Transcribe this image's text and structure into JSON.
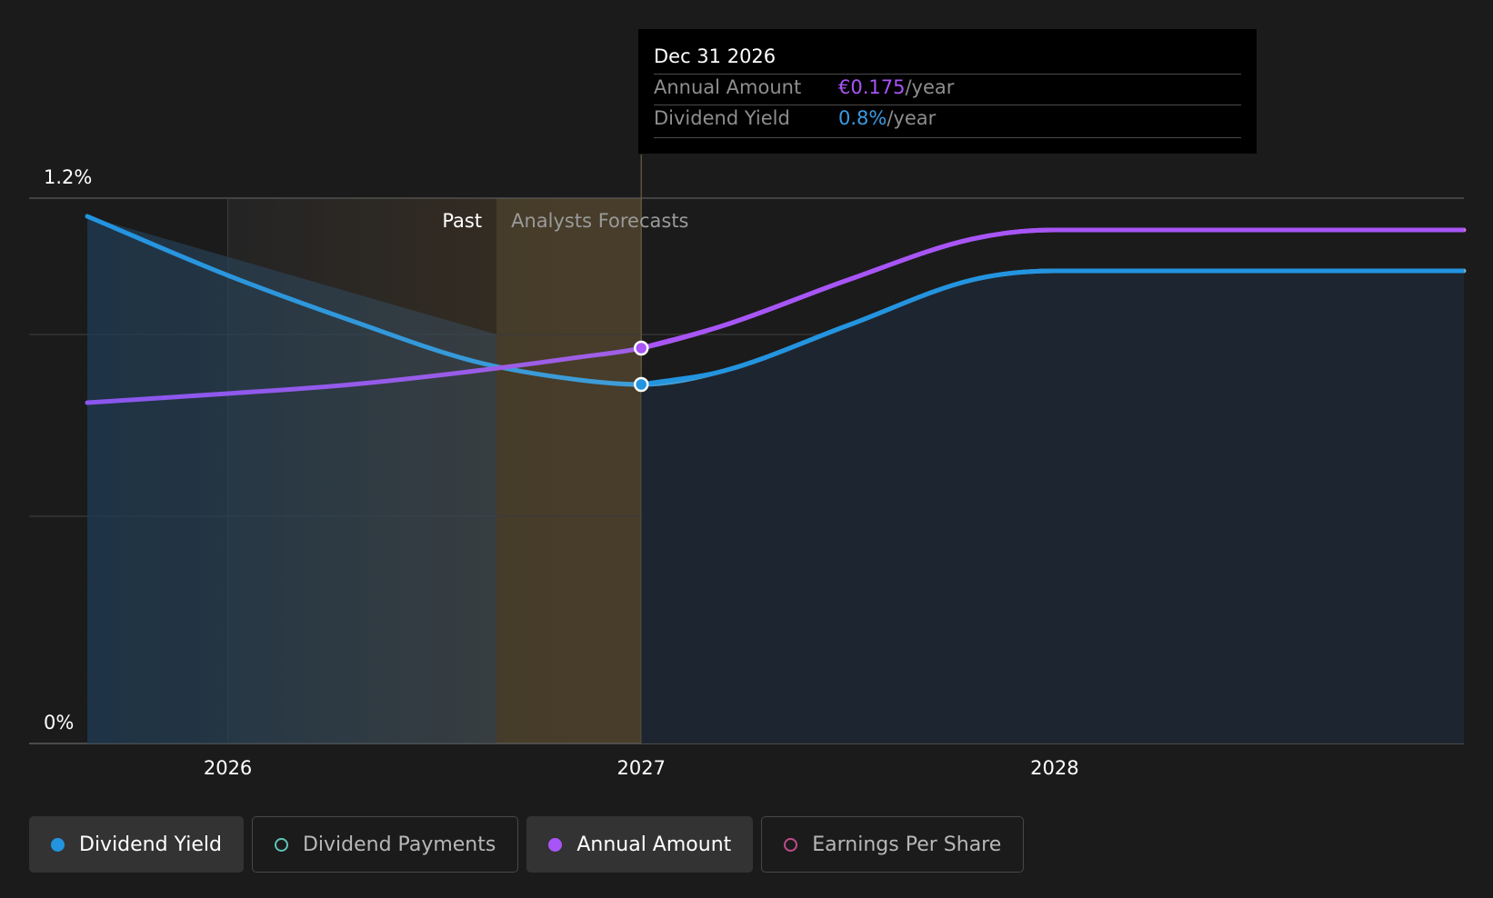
{
  "tooltip": {
    "date": "Dec 31 2026",
    "rows": [
      {
        "label": "Annual Amount",
        "value": "€0.175",
        "unit": "/year",
        "color": "#a855f7"
      },
      {
        "label": "Dividend Yield",
        "value": "0.8%",
        "unit": "/year",
        "color": "#3b9ae1"
      }
    ]
  },
  "regions": {
    "past_label": "Past",
    "forecast_label": "Analysts Forecasts"
  },
  "legend": [
    {
      "label": "Dividend Yield",
      "color": "#2394e0",
      "active": true
    },
    {
      "label": "Dividend Payments",
      "color": "#5ec4b6",
      "active": false
    },
    {
      "label": "Annual Amount",
      "color": "#a855f7",
      "active": true
    },
    {
      "label": "Earnings Per Share",
      "color": "#c04c8b",
      "active": false
    }
  ],
  "chart_data": {
    "type": "line",
    "y_tick_labels": [
      "1.2%",
      "0%"
    ],
    "ylim": [
      0,
      1.2
    ],
    "x_tick_labels": [
      "2026",
      "2027",
      "2028"
    ],
    "xlim": [
      2025.66,
      2028.99
    ],
    "highlight_x": 2027.0,
    "past_end_x": 2026.65,
    "series": [
      {
        "name": "Dividend Yield",
        "color": "#2394e0",
        "x": [
          2025.66,
          2026.0,
          2026.3,
          2026.6,
          2026.85,
          2027.0,
          2027.2,
          2027.5,
          2027.8,
          2028.0,
          2028.99
        ],
        "y": [
          1.16,
          1.03,
          0.93,
          0.84,
          0.8,
          0.79,
          0.82,
          0.92,
          1.02,
          1.04,
          1.04
        ]
      },
      {
        "name": "Annual Amount",
        "color": "#a855f7",
        "x": [
          2025.66,
          2026.0,
          2026.3,
          2026.6,
          2026.85,
          2027.0,
          2027.2,
          2027.5,
          2027.8,
          2028.0,
          2028.99
        ],
        "y": [
          0.75,
          0.77,
          0.79,
          0.82,
          0.85,
          0.87,
          0.92,
          1.02,
          1.11,
          1.13,
          1.13
        ]
      }
    ]
  }
}
